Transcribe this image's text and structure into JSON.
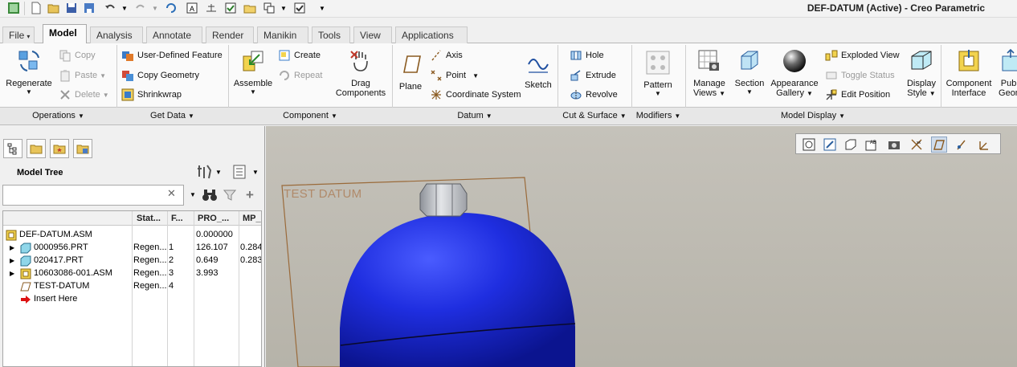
{
  "window": {
    "title": "DEF-DATUM (Active) - Creo Parametric"
  },
  "tabs": [
    {
      "label": "File",
      "has_caret": true
    },
    {
      "label": "Model"
    },
    {
      "label": "Analysis"
    },
    {
      "label": "Annotate"
    },
    {
      "label": "Render"
    },
    {
      "label": "Manikin"
    },
    {
      "label": "Tools"
    },
    {
      "label": "View"
    },
    {
      "label": "Applications"
    }
  ],
  "ribbon": {
    "operations": {
      "regenerate": "Regenerate",
      "copy": "Copy",
      "paste": "Paste",
      "delete": "Delete",
      "group_label": "Operations"
    },
    "get_data": {
      "udf": "User-Defined Feature",
      "copy_geometry": "Copy Geometry",
      "shrinkwrap": "Shrinkwrap",
      "group_label": "Get Data"
    },
    "component": {
      "assemble": "Assemble",
      "create": "Create",
      "repeat": "Repeat",
      "drag_components_1": "Drag",
      "drag_components_2": "Components",
      "group_label": "Component"
    },
    "datum": {
      "plane": "Plane",
      "axis": "Axis",
      "point": "Point",
      "csys": "Coordinate System",
      "sketch": "Sketch",
      "group_label": "Datum"
    },
    "cut_surface": {
      "hole": "Hole",
      "extrude": "Extrude",
      "revolve": "Revolve",
      "group_label": "Cut & Surface"
    },
    "modifiers": {
      "pattern": "Pattern",
      "group_label": "Modifiers"
    },
    "model_display": {
      "manage_views_1": "Manage",
      "manage_views_2": "Views",
      "section": "Section",
      "appearance_1": "Appearance",
      "appearance_2": "Gallery",
      "exploded_view": "Exploded View",
      "toggle_status": "Toggle Status",
      "edit_position": "Edit Position",
      "display_style_1": "Display",
      "display_style_2": "Style",
      "group_label": "Model Display"
    },
    "component_interface_1": "Component",
    "component_interface_2": "Interface",
    "publish_geom_1": "Publi",
    "publish_geom_2": "Geom"
  },
  "model_tree": {
    "title": "Model Tree",
    "search_value": "",
    "columns": [
      "Stat...",
      "F...",
      "PRO_...",
      "MP_"
    ],
    "rows": [
      {
        "name": "DEF-DATUM.ASM",
        "status": "",
        "feat": "",
        "pro": "0.000000",
        "mp": "",
        "expand": false,
        "icon": "assembly-icon"
      },
      {
        "name": "0000956.PRT",
        "status": "Regen...",
        "feat": "1",
        "pro": "126.107",
        "mp": "0.284",
        "expand": true,
        "icon": "part-icon"
      },
      {
        "name": "020417.PRT",
        "status": "Regen...",
        "feat": "2",
        "pro": "0.649",
        "mp": "0.283",
        "expand": true,
        "icon": "part-icon"
      },
      {
        "name": "10603086-001.ASM",
        "status": "Regen...",
        "feat": "3",
        "pro": "3.993",
        "mp": "",
        "expand": true,
        "icon": "assembly-icon"
      },
      {
        "name": "TEST-DATUM",
        "status": "Regen...",
        "feat": "4",
        "pro": "",
        "mp": "",
        "expand": false,
        "icon": "datum-plane-icon"
      },
      {
        "name": "Insert Here",
        "status": "",
        "feat": "",
        "pro": "",
        "mp": "",
        "expand": false,
        "icon": "insert-here-arrow-icon"
      }
    ]
  },
  "viewport": {
    "datum_label": "TEST DATUM",
    "colors": {
      "body": "#1f2ee0",
      "nut": "#c9ccd2",
      "datum_plane": "#9a6a3a",
      "background": "#bdbab2"
    }
  },
  "colors": {
    "accent": "#3a6ea5",
    "ribbon_bg": "#fafafa",
    "tree_bg": "#ffffff"
  }
}
